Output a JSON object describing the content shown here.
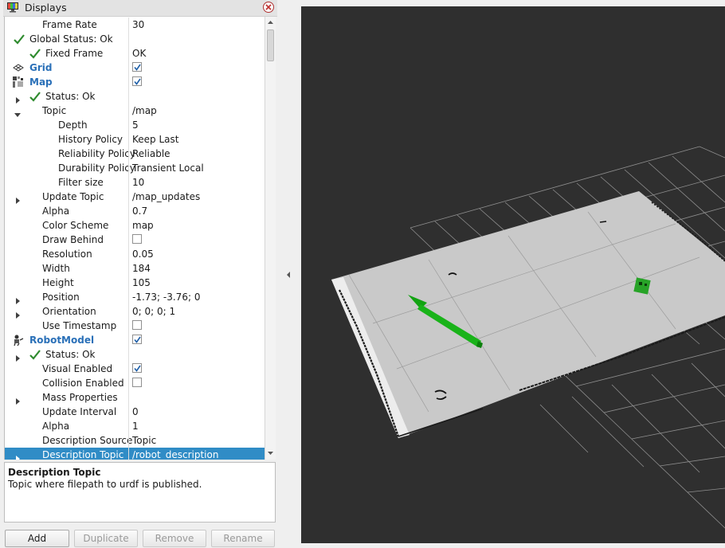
{
  "panel": {
    "title": "Displays",
    "help_title": "Description Topic",
    "help_text": "Topic where filepath to urdf is published.",
    "buttons": {
      "add": "Add",
      "duplicate": "Duplicate",
      "remove": "Remove",
      "rename": "Rename"
    }
  },
  "rows": [
    {
      "name": "Frame Rate",
      "value": "30",
      "indent": 1
    },
    {
      "name": "Global Status: Ok",
      "indent": 0,
      "check": true
    },
    {
      "name": "Fixed Frame",
      "value": "OK",
      "indent": 1,
      "check": true
    },
    {
      "name": "Grid",
      "indent": 0,
      "plugin": true,
      "icon": "grid",
      "cb": true
    },
    {
      "name": "Map",
      "indent": 0,
      "plugin": true,
      "icon": "map",
      "cb": true
    },
    {
      "name": "Status: Ok",
      "indent": 1,
      "check": true,
      "expander": "right"
    },
    {
      "name": "Topic",
      "value": "/map",
      "indent": 1,
      "expander": "down"
    },
    {
      "name": "Depth",
      "value": "5",
      "indent": 2
    },
    {
      "name": "History Policy",
      "value": "Keep Last",
      "indent": 2
    },
    {
      "name": "Reliability Policy",
      "value": "Reliable",
      "indent": 2
    },
    {
      "name": "Durability Policy",
      "value": "Transient Local",
      "indent": 2
    },
    {
      "name": "Filter size",
      "value": "10",
      "indent": 2
    },
    {
      "name": "Update Topic",
      "value": "/map_updates",
      "indent": 1,
      "expander": "right"
    },
    {
      "name": "Alpha",
      "value": "0.7",
      "indent": 1
    },
    {
      "name": "Color Scheme",
      "value": "map",
      "indent": 1
    },
    {
      "name": "Draw Behind",
      "indent": 1,
      "cb": false
    },
    {
      "name": "Resolution",
      "value": "0.05",
      "indent": 1
    },
    {
      "name": "Width",
      "value": "184",
      "indent": 1
    },
    {
      "name": "Height",
      "value": "105",
      "indent": 1
    },
    {
      "name": "Position",
      "value": "-1.73; -3.76; 0",
      "indent": 1,
      "expander": "right"
    },
    {
      "name": "Orientation",
      "value": "0; 0; 0; 1",
      "indent": 1,
      "expander": "right"
    },
    {
      "name": "Use Timestamp",
      "indent": 1,
      "cb": false
    },
    {
      "name": "RobotModel",
      "indent": 0,
      "plugin": true,
      "icon": "robot",
      "cb": true
    },
    {
      "name": "Status: Ok",
      "indent": 1,
      "check": true,
      "expander": "right"
    },
    {
      "name": "Visual Enabled",
      "indent": 1,
      "cb": true
    },
    {
      "name": "Collision Enabled",
      "indent": 1,
      "cb": false
    },
    {
      "name": "Mass Properties",
      "indent": 1,
      "expander": "right"
    },
    {
      "name": "Update Interval",
      "value": "0",
      "indent": 1
    },
    {
      "name": "Alpha",
      "value": "1",
      "indent": 1
    },
    {
      "name": "Description Source",
      "value": "Topic",
      "indent": 1
    },
    {
      "name": "Description Topic",
      "value": "/robot_description",
      "indent": 1,
      "expander": "right",
      "selected": true
    }
  ],
  "colors": {
    "selection": "#308cc6",
    "plugin_name": "#2a70b8",
    "check": "#2e8b2e",
    "viewport_bg": "#2f2f2f",
    "map_free": "#c9c9c9",
    "arrow": "#19b319",
    "robot": "#27a327"
  }
}
